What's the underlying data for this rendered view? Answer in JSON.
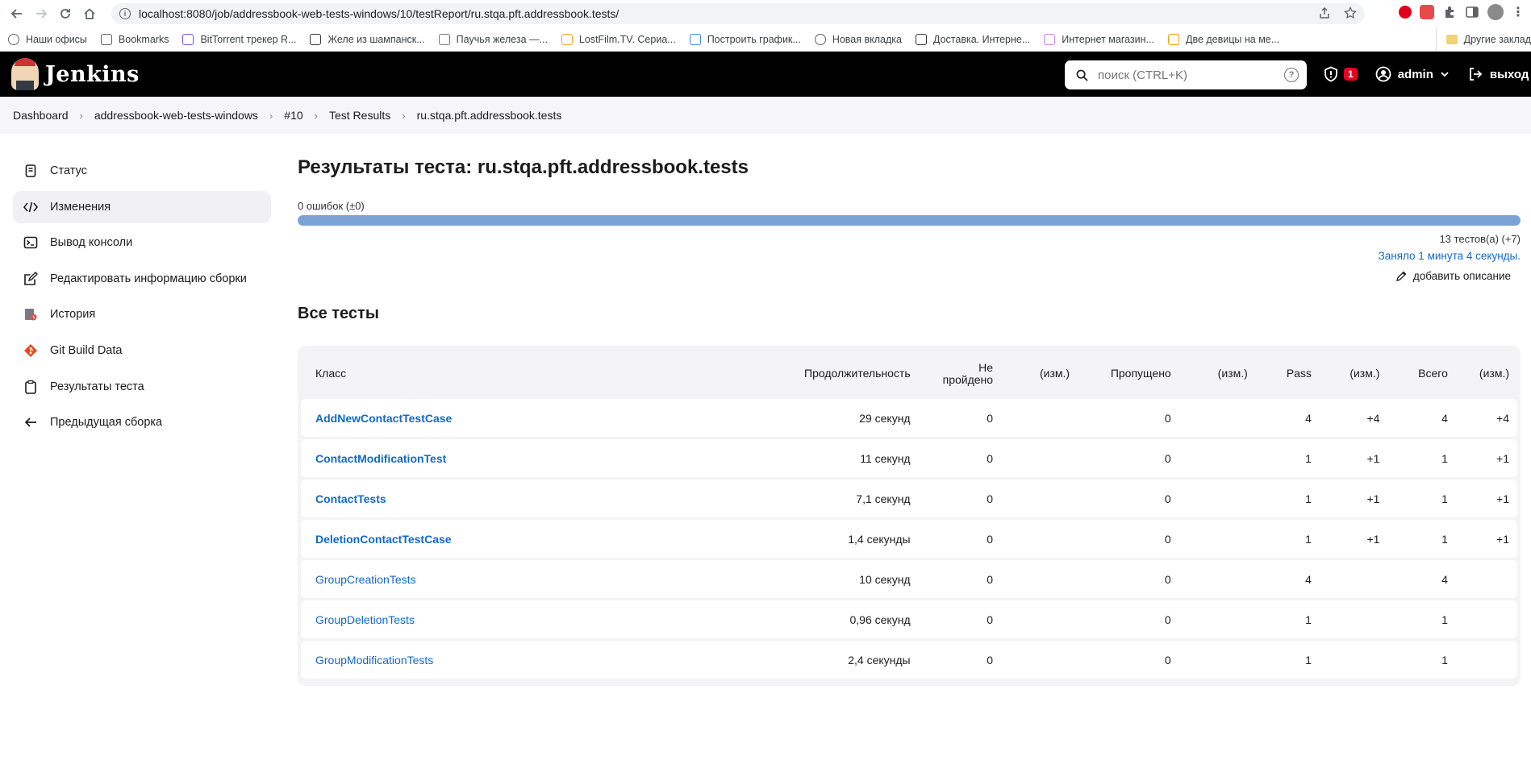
{
  "browser": {
    "url": "localhost:8080/job/addressbook-web-tests-windows/10/testReport/ru.stqa.pft.addressbook.tests/",
    "bookmarks": [
      {
        "label": "Наши офисы",
        "icon": "globe-icon",
        "color": "#5f6368"
      },
      {
        "label": "Bookmarks",
        "icon": "star-icon",
        "color": "#5f6368"
      },
      {
        "label": "BitTorrent трекер R...",
        "icon": "torrent-icon",
        "color": "#7c4dff"
      },
      {
        "label": "Желе из шампанск...",
        "icon": "eda-icon",
        "color": "#333333"
      },
      {
        "label": "Паучья железа —...",
        "icon": "image-icon",
        "color": "#8d6e63"
      },
      {
        "label": "LostFilm.TV. Сериа...",
        "icon": "lf-icon",
        "color": "#f5a623"
      },
      {
        "label": "Построить график...",
        "icon": "google-icon",
        "color": "#4285f4"
      },
      {
        "label": "Новая вкладка",
        "icon": "globe-icon",
        "color": "#5f6368"
      },
      {
        "label": "Доставка. Интерне...",
        "icon": "delivery-icon",
        "color": "#333333"
      },
      {
        "label": "Интернет магазин...",
        "icon": "shop-icon",
        "color": "#d081e0"
      },
      {
        "label": "Две девицы на ме...",
        "icon": "fs-icon",
        "color": "#f5a000"
      }
    ],
    "other_bookmarks": "Другие заклад"
  },
  "jenkins": {
    "title": "Jenkins",
    "search_placeholder": "поиск (CTRL+K)",
    "security_count": "1",
    "user": "admin",
    "logout": "выход"
  },
  "breadcrumb": [
    "Dashboard",
    "addressbook-web-tests-windows",
    "#10",
    "Test Results",
    "ru.stqa.pft.addressbook.tests"
  ],
  "sidebar": [
    {
      "label": "Статус",
      "icon": "notepad-icon"
    },
    {
      "label": "Изменения",
      "icon": "code-icon"
    },
    {
      "label": "Вывод консоли",
      "icon": "terminal-icon"
    },
    {
      "label": "Редактировать информацию сборки",
      "icon": "edit-icon"
    },
    {
      "label": "История",
      "icon": "history-icon"
    },
    {
      "label": "Git Build Data",
      "icon": "git-icon"
    },
    {
      "label": "Результаты теста",
      "icon": "clipboard-icon"
    },
    {
      "label": "Предыдущая сборка",
      "icon": "arrow-left-icon"
    }
  ],
  "report": {
    "title": "Результаты теста: ru.stqa.pft.addressbook.tests",
    "failures": "0 ошибок (±0)",
    "pass_fraction": 1.0,
    "test_count": "13 тестов(а) (+7)",
    "took": "Заняло 1 минута 4 секунды.",
    "add_description": "добавить описание",
    "section_title": "Все тесты",
    "progress_color": "#7aa2d6"
  },
  "table": {
    "headers": {
      "cls": "Класс",
      "duration": "Продолжительность",
      "failed": "Не пройдено",
      "failed_diff": "(изм.)",
      "skipped": "Пропущено",
      "skipped_diff": "(изм.)",
      "pass": "Pass",
      "pass_diff": "(изм.)",
      "total": "Всего",
      "total_diff": "(изм.)"
    },
    "rows": [
      {
        "cls": "AddNewContactTestCase",
        "bold": true,
        "duration": "29 секунд",
        "failed": "0",
        "failed_diff": "",
        "skipped": "0",
        "skipped_diff": "",
        "pass": "4",
        "pass_diff": "+4",
        "total": "4",
        "total_diff": "+4"
      },
      {
        "cls": "ContactModificationTest",
        "bold": true,
        "duration": "11 секунд",
        "failed": "0",
        "failed_diff": "",
        "skipped": "0",
        "skipped_diff": "",
        "pass": "1",
        "pass_diff": "+1",
        "total": "1",
        "total_diff": "+1"
      },
      {
        "cls": "ContactTests",
        "bold": true,
        "duration": "7,1 секунд",
        "failed": "0",
        "failed_diff": "",
        "skipped": "0",
        "skipped_diff": "",
        "pass": "1",
        "pass_diff": "+1",
        "total": "1",
        "total_diff": "+1"
      },
      {
        "cls": "DeletionContactTestCase",
        "bold": true,
        "duration": "1,4 секунды",
        "failed": "0",
        "failed_diff": "",
        "skipped": "0",
        "skipped_diff": "",
        "pass": "1",
        "pass_diff": "+1",
        "total": "1",
        "total_diff": "+1"
      },
      {
        "cls": "GroupCreationTests",
        "bold": false,
        "duration": "10 секунд",
        "failed": "0",
        "failed_diff": "",
        "skipped": "0",
        "skipped_diff": "",
        "pass": "4",
        "pass_diff": "",
        "total": "4",
        "total_diff": ""
      },
      {
        "cls": "GroupDeletionTests",
        "bold": false,
        "duration": "0,96 секунд",
        "failed": "0",
        "failed_diff": "",
        "skipped": "0",
        "skipped_diff": "",
        "pass": "1",
        "pass_diff": "",
        "total": "1",
        "total_diff": ""
      },
      {
        "cls": "GroupModificationTests",
        "bold": false,
        "duration": "2,4 секунды",
        "failed": "0",
        "failed_diff": "",
        "skipped": "0",
        "skipped_diff": "",
        "pass": "1",
        "pass_diff": "",
        "total": "1",
        "total_diff": ""
      }
    ]
  }
}
